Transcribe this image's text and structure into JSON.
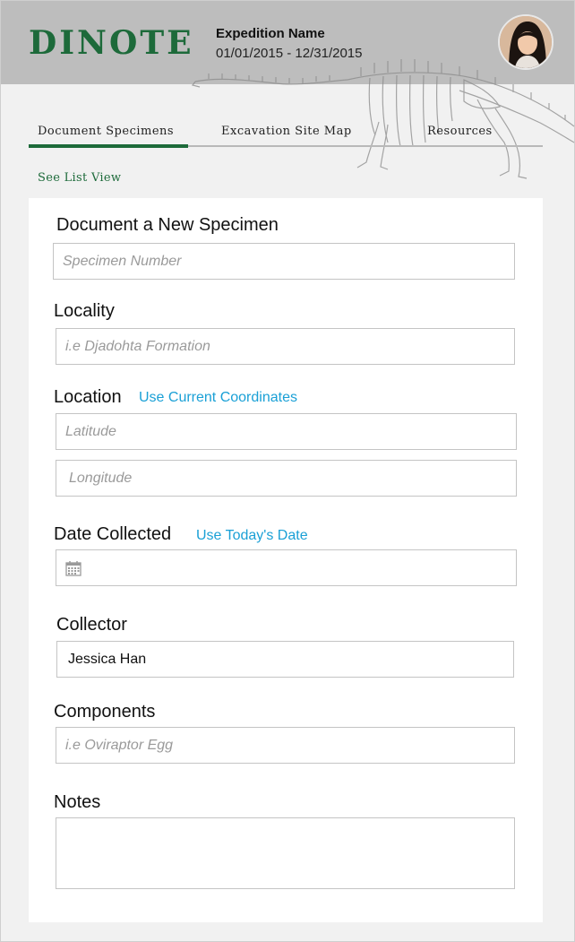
{
  "app": {
    "logo": "DINOTE",
    "expedition_name": "Expedition Name",
    "expedition_dates": "01/01/2015 - 12/31/2015",
    "brand_color": "#1d6a3a",
    "link_color": "#1aa0d6"
  },
  "tabs": [
    {
      "label": "Document Specimens",
      "active": true
    },
    {
      "label": "Excavation Site Map",
      "active": false
    },
    {
      "label": "Resources",
      "active": false
    }
  ],
  "list_view_link": "See List View",
  "form": {
    "title": "Document a New Specimen",
    "specimen_number": {
      "placeholder": "Specimen Number",
      "value": ""
    },
    "locality": {
      "label": "Locality",
      "placeholder": "i.e Djadohta Formation",
      "value": ""
    },
    "location": {
      "label": "Location",
      "use_current_link": "Use Current Coordinates",
      "latitude_placeholder": "Latitude",
      "longitude_placeholder": "Longitude"
    },
    "date_collected": {
      "label": "Date Collected",
      "use_today_link": "Use Today's Date",
      "value": "",
      "icon": "calendar-icon"
    },
    "collector": {
      "label": "Collector",
      "value": "Jessica Han"
    },
    "components": {
      "label": "Components",
      "placeholder": "i.e Oviraptor Egg",
      "value": ""
    },
    "notes": {
      "label": "Notes",
      "value": ""
    }
  }
}
